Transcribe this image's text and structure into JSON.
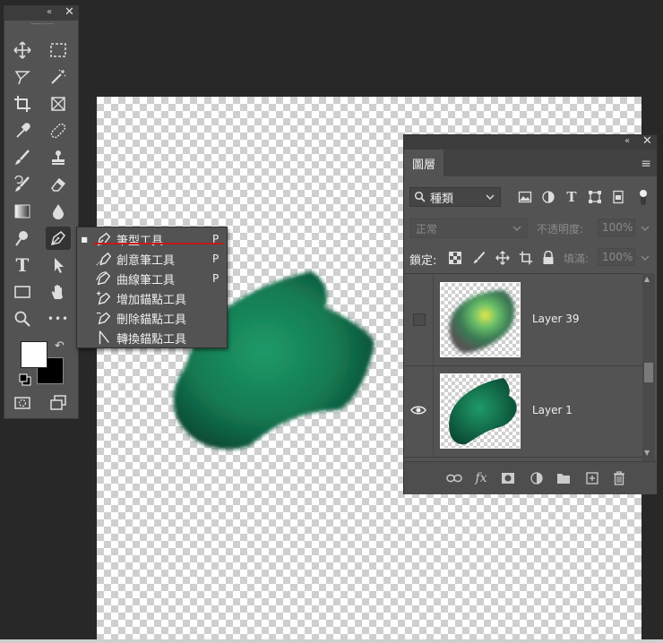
{
  "toolbar": {
    "collapse_label": "«",
    "close_label": "✕",
    "tools": [
      {
        "name": "move-tool"
      },
      {
        "name": "marquee-tool"
      },
      {
        "name": "lasso-tool"
      },
      {
        "name": "magic-wand-tool"
      },
      {
        "name": "crop-tool"
      },
      {
        "name": "frame-tool"
      },
      {
        "name": "eyedropper-tool"
      },
      {
        "name": "healing-brush-tool"
      },
      {
        "name": "brush-tool"
      },
      {
        "name": "clone-stamp-tool"
      },
      {
        "name": "history-brush-tool"
      },
      {
        "name": "eraser-tool"
      },
      {
        "name": "gradient-tool"
      },
      {
        "name": "blur-tool"
      },
      {
        "name": "dodge-tool"
      },
      {
        "name": "pen-tool"
      },
      {
        "name": "type-tool"
      },
      {
        "name": "path-selection-tool"
      },
      {
        "name": "rectangle-tool"
      },
      {
        "name": "hand-tool"
      },
      {
        "name": "zoom-tool"
      },
      {
        "name": "more-tools"
      }
    ],
    "type_tool_glyph": "T",
    "more_glyph": "•••",
    "swap_glyph": "↶",
    "foreground_color": "#ffffff",
    "background_color": "#000000"
  },
  "flyout": {
    "items": [
      {
        "label": "筆型工具",
        "key": "P",
        "selected": true,
        "icon": "pen-icon"
      },
      {
        "label": "創意筆工具",
        "key": "P",
        "selected": false,
        "icon": "freeform-pen-icon"
      },
      {
        "label": "曲線筆工具",
        "key": "P",
        "selected": false,
        "icon": "curvature-pen-icon"
      },
      {
        "label": "增加錨點工具",
        "key": "",
        "selected": false,
        "icon": "add-anchor-icon"
      },
      {
        "label": "刪除錨點工具",
        "key": "",
        "selected": false,
        "icon": "delete-anchor-icon"
      },
      {
        "label": "轉換錨點工具",
        "key": "",
        "selected": false,
        "icon": "convert-point-icon"
      }
    ],
    "selected_marker": "■"
  },
  "layers_panel": {
    "collapse_label": "«",
    "close_label": "✕",
    "tab_label": "圖層",
    "menu_glyph": "≡",
    "filter_kind": "種類",
    "blend_mode": "正常",
    "opacity_label": "不透明度:",
    "opacity_value": "100%",
    "lock_label": "鎖定:",
    "fill_label": "填滿:",
    "fill_value": "100%",
    "layers": [
      {
        "name": "Layer 39",
        "visible": false
      },
      {
        "name": "Layer 1",
        "visible": true
      }
    ],
    "fx_label": "fx"
  },
  "colors": {
    "accent_underline": "#c01a1a",
    "paint_green": "#1a8a5c"
  }
}
